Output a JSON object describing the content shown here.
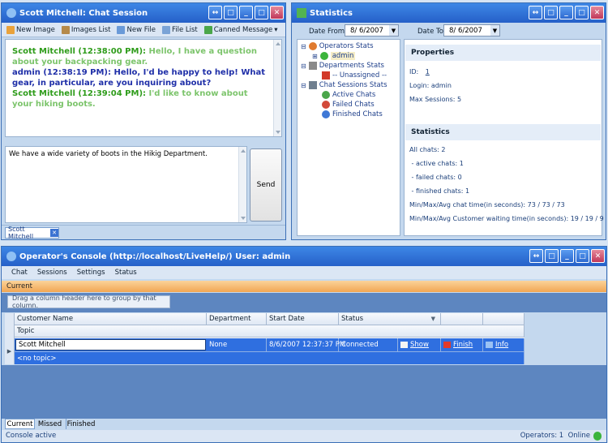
{
  "chat_window": {
    "title": "Scott Mitchell: Chat Session",
    "toolbar": [
      "New Image",
      "Images List",
      "New File",
      "File List",
      "Canned Message"
    ],
    "messages": [
      {
        "who": "Scott Mitchell (12:38:00 PM):",
        "text": "Hello, I have a question about your backpacking gear.",
        "color": "#2e9c1a",
        "tcolor": "#7cc46b"
      },
      {
        "who": "admin (12:38:19 PM):",
        "text": "Hello, I'd be happy to help! What gear, in particular, are you inquiring about?",
        "color": "#1f2fa8",
        "tcolor": "#1f2fa8"
      },
      {
        "who": "Scott Mitchell (12:39:04 PM):",
        "text": "I'd like to know about your hiking boots.",
        "color": "#2e9c1a",
        "tcolor": "#7cc46b"
      }
    ],
    "input_text": "We have a wide variety of boots in the Hikig Department.",
    "send_label": "Send",
    "tab_label": "Scott Mitchell"
  },
  "stats_window": {
    "title": "Statistics",
    "date_from_label": "Date From:",
    "date_from": "8/ 6/2007",
    "date_to_label": "Date To:",
    "date_to": "8/ 6/2007",
    "tree": {
      "operators": "Operators Stats",
      "admin": "admin",
      "departments": "Departments Stats",
      "unassigned": "-- Unassigned --",
      "sessions": "Chat Sessions Stats",
      "active": "Active Chats",
      "failed": "Failed Chats",
      "finished": "Finished Chats"
    },
    "properties": {
      "title": "Properties",
      "id_label": "ID:",
      "id_value": "1",
      "login": "Login: admin",
      "max_sessions": "Max Sessions: 5"
    },
    "statistics": {
      "title": "Statistics",
      "lines": [
        "All chats: 2",
        " - active chats: 1",
        " - failed chats: 0",
        " - finished chats: 1",
        "Min/Max/Avg chat time(in seconds): 73 / 73 / 73",
        "Min/Max/Avg Customer waiting time(in seconds): 19 / 19 / 9"
      ]
    }
  },
  "console_window": {
    "title": "Operator's Console (http://localhost/LiveHelp/) User: admin",
    "menu": [
      "Chat",
      "Sessions",
      "Settings",
      "Status"
    ],
    "section": "Current",
    "group_hint": "Drag a column header here to group by that column.",
    "columns": [
      "Customer Name",
      "Department",
      "Start Date",
      "Status"
    ],
    "subcolumn": "Topic",
    "row": {
      "customer": "Scott Mitchell",
      "department": "None",
      "start": "8/6/2007 12:37:37 PM",
      "status": "Connected",
      "show": "Show",
      "finish": "Finish",
      "info": "Info",
      "topic": "<no topic>"
    },
    "tabs": [
      "Current",
      "Missed",
      "Finished"
    ],
    "status_left": "Console active",
    "status_right": "Operators: 1  Online"
  }
}
